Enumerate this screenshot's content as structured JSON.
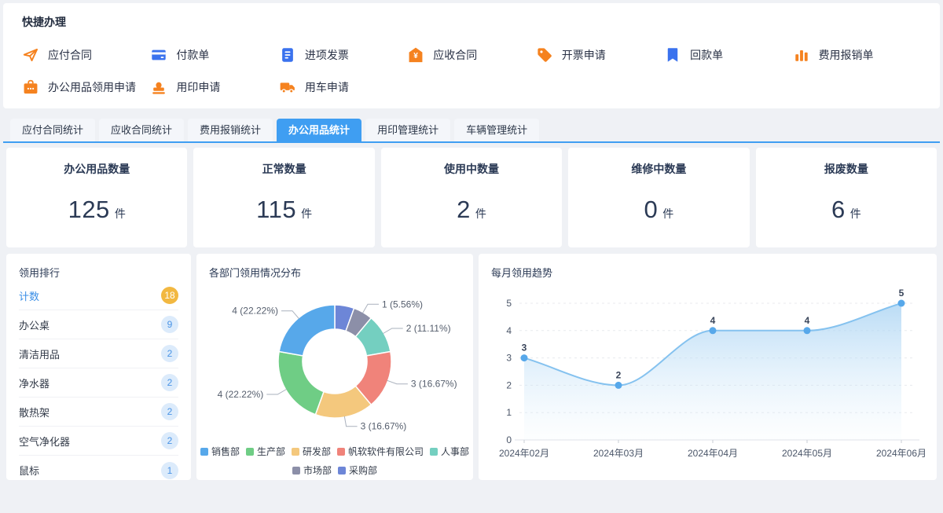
{
  "quick_panel": {
    "title": "快捷办理",
    "items": [
      {
        "label": "应付合同",
        "icon": "send"
      },
      {
        "label": "付款单",
        "icon": "payment-card"
      },
      {
        "label": "进项发票",
        "icon": "invoice-doc"
      },
      {
        "label": "应收合同",
        "icon": "yuan-badge"
      },
      {
        "label": "开票申请",
        "icon": "tag"
      },
      {
        "label": "回款单",
        "icon": "bookmark"
      },
      {
        "label": "费用报销单",
        "icon": "bar-chart"
      },
      {
        "label": "办公用品领用申请",
        "icon": "toolbox"
      },
      {
        "label": "用印申请",
        "icon": "stamp"
      },
      {
        "label": "用车申请",
        "icon": "truck"
      }
    ]
  },
  "tabs": [
    {
      "label": "应付合同统计",
      "active": false
    },
    {
      "label": "应收合同统计",
      "active": false
    },
    {
      "label": "费用报销统计",
      "active": false
    },
    {
      "label": "办公用品统计",
      "active": true
    },
    {
      "label": "用印管理统计",
      "active": false
    },
    {
      "label": "车辆管理统计",
      "active": false
    }
  ],
  "stat_cards": [
    {
      "label": "办公用品数量",
      "value": "125",
      "unit": "件"
    },
    {
      "label": "正常数量",
      "value": "115",
      "unit": "件"
    },
    {
      "label": "使用中数量",
      "value": "2",
      "unit": "件"
    },
    {
      "label": "维修中数量",
      "value": "0",
      "unit": "件"
    },
    {
      "label": "报废数量",
      "value": "6",
      "unit": "件"
    }
  ],
  "rank_panel": {
    "title": "领用排行",
    "rows": [
      {
        "label": "计数",
        "value": "18",
        "highlight": true
      },
      {
        "label": "办公桌",
        "value": "9",
        "highlight": false
      },
      {
        "label": "清洁用品",
        "value": "2",
        "highlight": false
      },
      {
        "label": "净水器",
        "value": "2",
        "highlight": false
      },
      {
        "label": "散热架",
        "value": "2",
        "highlight": false
      },
      {
        "label": "空气净化器",
        "value": "2",
        "highlight": false
      },
      {
        "label": "鼠标",
        "value": "1",
        "highlight": false
      }
    ]
  },
  "chart_data": [
    {
      "type": "pie",
      "title": "各部门领用情况分布",
      "donut": true,
      "total": 18,
      "slices": [
        {
          "name": "采购部",
          "value": 1,
          "pct": "5.56%",
          "color": "#6d86d7",
          "label_visible": false
        },
        {
          "name": "市场部",
          "value": 1,
          "pct": "5.56%",
          "color": "#8c8fa8",
          "label_visible": true
        },
        {
          "name": "人事部",
          "value": 2,
          "pct": "11.11%",
          "color": "#74cfc0",
          "label_visible": true
        },
        {
          "name": "帆软软件有限公司",
          "value": 3,
          "pct": "16.67%",
          "color": "#f0837a",
          "label_visible": true
        },
        {
          "name": "研发部",
          "value": 3,
          "pct": "16.67%",
          "color": "#f4c87d",
          "label_visible": true
        },
        {
          "name": "生产部",
          "value": 4,
          "pct": "22.22%",
          "color": "#6fcd85",
          "label_visible": true
        },
        {
          "name": "销售部",
          "value": 4,
          "pct": "22.22%",
          "color": "#57a8ea",
          "label_visible": true
        }
      ],
      "legend_order": [
        "销售部",
        "生产部",
        "研发部",
        "帆软软件有限公司",
        "人事部",
        "市场部",
        "采购部"
      ],
      "legend_position": "bottom"
    },
    {
      "type": "area",
      "title": "每月领用趋势",
      "x": [
        "2024年02月",
        "2024年03月",
        "2024年04月",
        "2024年05月",
        "2024年06月"
      ],
      "values": [
        3,
        2,
        4,
        4,
        5
      ],
      "ylim": [
        0,
        5
      ],
      "yticks": [
        0,
        1,
        2,
        3,
        4,
        5
      ],
      "grid": "dashed",
      "smooth": true,
      "line_color": "#85c2ef",
      "point_color": "#57a8ea",
      "area_top_color": "#a9d3f3"
    }
  ],
  "colors": {
    "accent_blue": "#3f9ef2",
    "icon_orange": "#f5821f",
    "icon_blue": "#3a72ee",
    "badge_orange": "#f2b841",
    "badge_blue_bg": "#dcebfb",
    "badge_blue_text": "#4a94e6",
    "rank_highlight_text": "#3a8ee6",
    "page_bg": "#eff1f5"
  }
}
